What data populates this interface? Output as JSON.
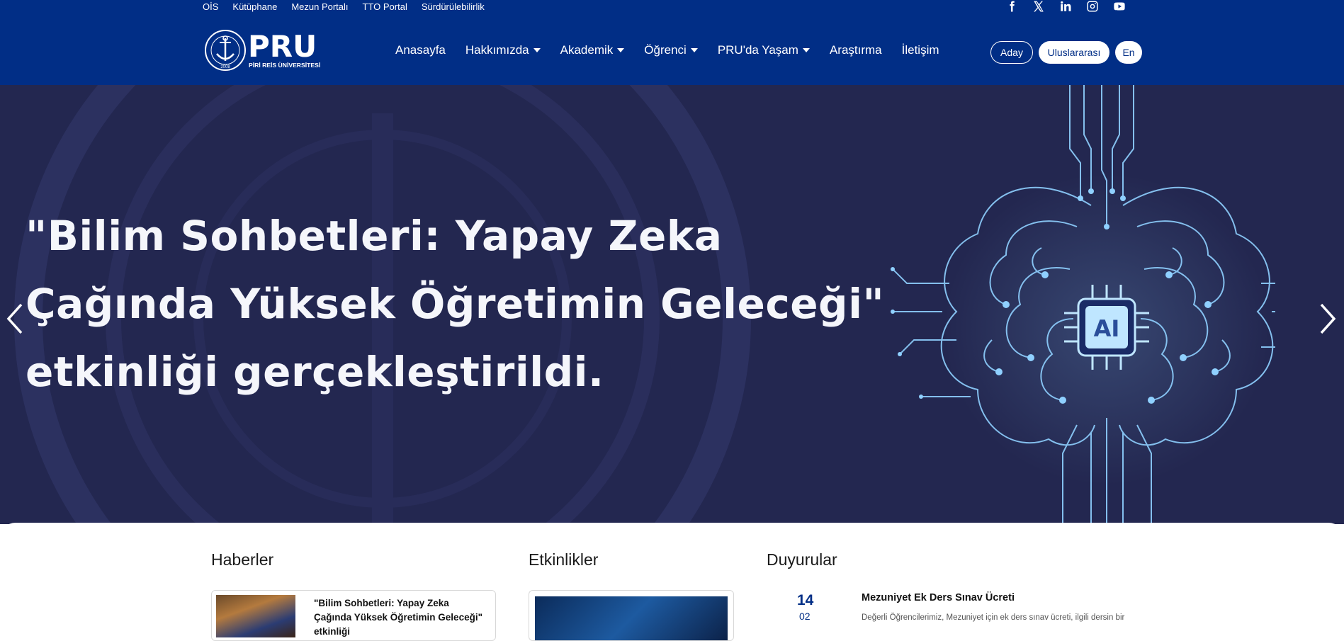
{
  "header": {
    "top_links": [
      "OİS",
      "Kütüphane",
      "Mezun Portalı",
      "TTO Portal",
      "Sürdürülebilirlik"
    ],
    "socials": [
      "facebook-icon",
      "x-icon",
      "linkedin-icon",
      "instagram-icon",
      "youtube-icon"
    ],
    "logo": {
      "text": "PRU",
      "subtext": "PİRİ REİS ÜNİVERSİTESİ",
      "year": "2008"
    },
    "nav": {
      "home": "Anasayfa",
      "about": "Hakkımızda",
      "academic": "Akademik",
      "student": "Öğrenci",
      "life": "PRU'da Yaşam",
      "research": "Araştırma",
      "contact": "İletişim"
    },
    "buttons": {
      "candidate": "Aday",
      "international": "Uluslararası",
      "lang": "En"
    }
  },
  "hero": {
    "title_lines": [
      "\"Bilim Sohbetleri: Yapay Zeka",
      "Çağında Yüksek Öğretimin Geleceği\"",
      "etkinliği gerçekleştirildi."
    ],
    "chip_label": "AI"
  },
  "sections": {
    "news": "Haberler",
    "events": "Etkinlikler",
    "announcements": "Duyurular"
  },
  "news_item": {
    "text": "\"Bilim Sohbetleri: Yapay Zeka Çağında Yüksek Öğretimin Geleceği\" etkinliği"
  },
  "announcement": {
    "day": "14",
    "month": "02",
    "title": "Mezuniyet Ek Ders Sınav Ücreti",
    "text": "Değerli Öğrencilerimiz, Mezuniyet için ek ders sınav ücreti, ilgili dersin bir"
  },
  "colors": {
    "brand": "#012e86",
    "hero_bg": "#232750",
    "glow": "#8fd0ff"
  }
}
